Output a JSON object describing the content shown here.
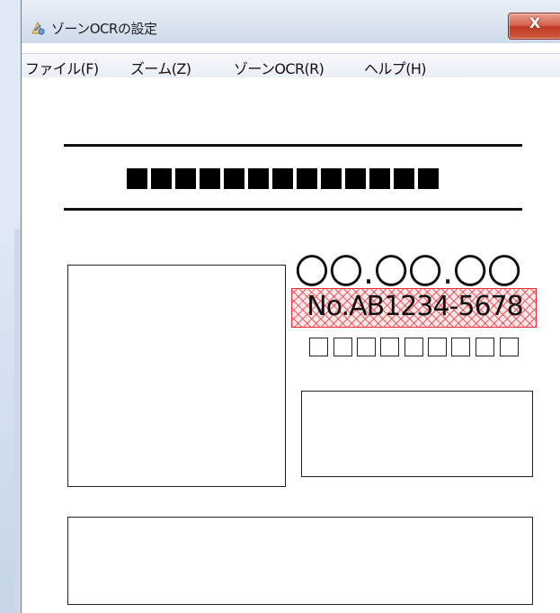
{
  "window": {
    "title": "ゾーンOCRの設定",
    "close_label": "X"
  },
  "menubar": {
    "items": [
      {
        "label": "ファイル(F)"
      },
      {
        "label": "ズーム(Z)"
      },
      {
        "label": "ゾーンOCR(R)"
      },
      {
        "label": "ヘルプ(H)"
      }
    ]
  },
  "document": {
    "date_text": "〇〇.〇〇.〇〇",
    "zone_text": "No.AB1234-5678",
    "zone_color": "#e8303a"
  }
}
